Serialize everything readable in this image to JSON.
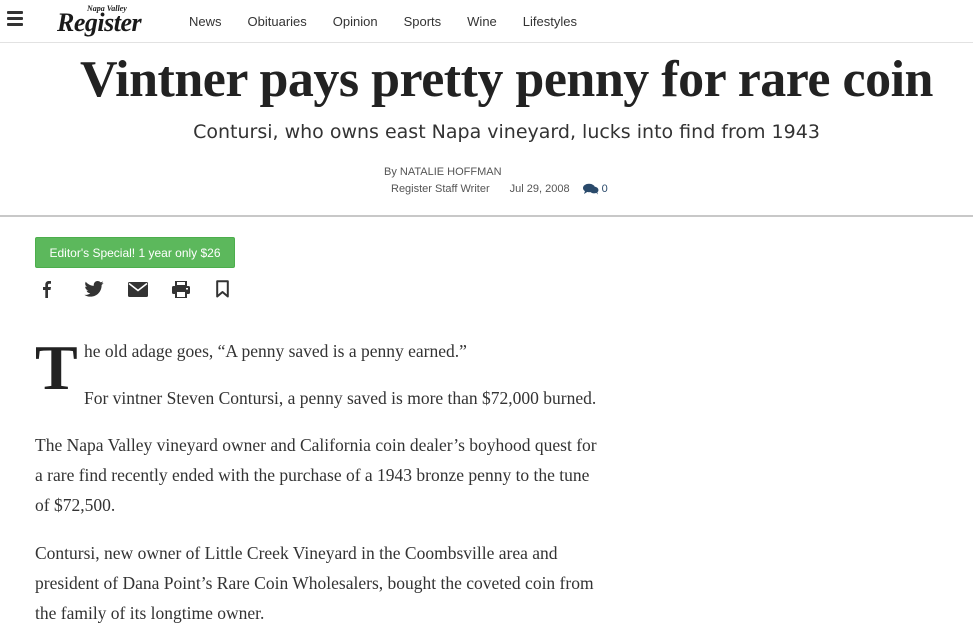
{
  "masthead": {
    "logo_small": "Napa Valley",
    "logo_big": "Register",
    "nav": [
      "News",
      "Obituaries",
      "Opinion",
      "Sports",
      "Wine",
      "Lifestyles"
    ]
  },
  "article": {
    "headline": "Vintner pays pretty penny for rare coin",
    "subhead": "Contursi, who owns east Napa vineyard, lucks into find from 1943",
    "byline_name": "By NATALIE HOFFMAN",
    "byline_role": "Register Staff Writer",
    "date": "Jul 29, 2008",
    "comment_count": "0",
    "promo": "Editor's Special! 1 year only $26",
    "dropcap": "T",
    "p1": "he old adage goes, “A penny saved is a penny earned.”",
    "p2": "For vintner Steven Contursi, a penny saved is more than $72,000 burned.",
    "p3_lines": [
      "The Napa Valley vineyard owner and California coin dealer’s boyhood quest for",
      "a rare find recently ended with the purchase of a 1943 bronze penny to the tune",
      "of $72,500."
    ],
    "p4_lines": [
      "Contursi, new owner of Little Creek Vineyard in the Coombsville area and",
      "president of Dana Point’s Rare Coin Wholesalers, bought the coveted coin from",
      "the family of its longtime owner."
    ]
  },
  "share_icons": [
    "facebook-icon",
    "twitter-icon",
    "email-icon",
    "print-icon",
    "bookmark-icon"
  ],
  "colors": {
    "promo_green": "#5cb85c",
    "comment_blue": "#2a4a6b"
  }
}
